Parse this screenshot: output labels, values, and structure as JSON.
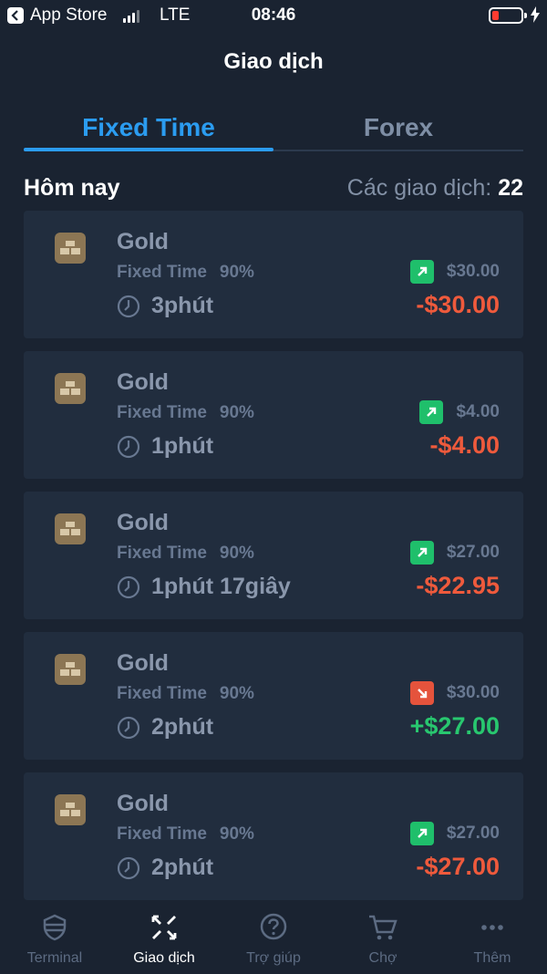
{
  "status_bar": {
    "carrier": "App Store",
    "network": "LTE",
    "time": "08:46"
  },
  "header": {
    "title": "Giao dịch"
  },
  "tabs": [
    {
      "label": "Fixed Time",
      "active": true
    },
    {
      "label": "Forex",
      "active": false
    }
  ],
  "section": {
    "title": "Hôm nay",
    "count_label": "Các giao dịch:",
    "count_value": "22"
  },
  "trades": [
    {
      "asset": "Gold",
      "type": "Fixed Time",
      "percent": "90%",
      "duration": "3phút",
      "direction": "up",
      "stake": "$30.00",
      "result": "-$30.00",
      "outcome": "loss"
    },
    {
      "asset": "Gold",
      "type": "Fixed Time",
      "percent": "90%",
      "duration": "1phút",
      "direction": "up",
      "stake": "$4.00",
      "result": "-$4.00",
      "outcome": "loss"
    },
    {
      "asset": "Gold",
      "type": "Fixed Time",
      "percent": "90%",
      "duration": "1phút 17giây",
      "direction": "up",
      "stake": "$27.00",
      "result": "-$22.95",
      "outcome": "loss"
    },
    {
      "asset": "Gold",
      "type": "Fixed Time",
      "percent": "90%",
      "duration": "2phút",
      "direction": "down",
      "stake": "$30.00",
      "result": "+$27.00",
      "outcome": "win"
    },
    {
      "asset": "Gold",
      "type": "Fixed Time",
      "percent": "90%",
      "duration": "2phút",
      "direction": "up",
      "stake": "$27.00",
      "result": "-$27.00",
      "outcome": "loss"
    }
  ],
  "bottom_nav": [
    {
      "label": "Terminal",
      "icon": "terminal-icon",
      "active": false
    },
    {
      "label": "Giao dịch",
      "icon": "trades-icon",
      "active": true
    },
    {
      "label": "Trợ giúp",
      "icon": "help-icon",
      "active": false
    },
    {
      "label": "Chợ",
      "icon": "cart-icon",
      "active": false
    },
    {
      "label": "Thêm",
      "icon": "more-icon",
      "active": false
    }
  ],
  "colors": {
    "background": "#1a2331",
    "card": "#212d3e",
    "accent": "#2b9cf0",
    "up": "#1fbf6b",
    "down": "#e5533c",
    "loss": "#ef5a3c",
    "win": "#28c76f"
  }
}
